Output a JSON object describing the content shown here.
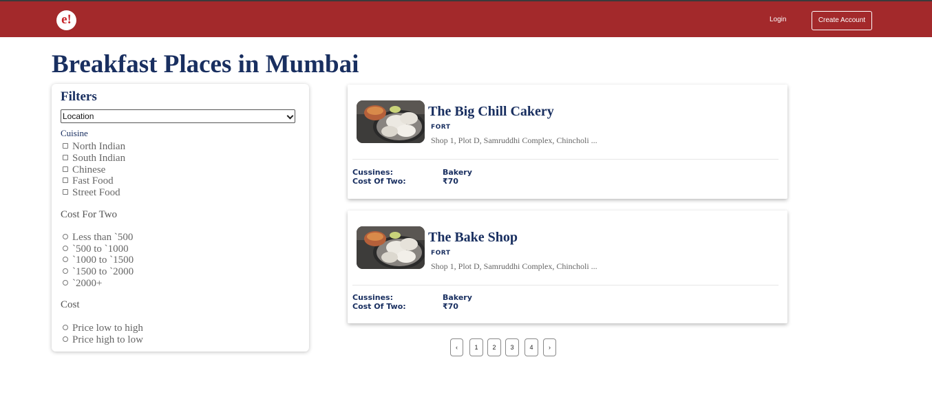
{
  "header": {
    "logo_text": "e!",
    "login_label": "Login",
    "create_account_label": "Create Account",
    "brand_color": "#a3292b"
  },
  "page": {
    "title": "Breakfast Places in Mumbai"
  },
  "filters": {
    "title": "Filters",
    "location_value": "Location",
    "cuisine_label": "Cuisine",
    "cuisines": [
      "North Indian",
      "South Indian",
      "Chinese",
      "Fast Food",
      "Street Food"
    ],
    "cost_label": "Cost For Two",
    "cost_options": [
      "Less than `500",
      "`500 to `1000",
      "`1000 to `1500",
      "`1500 to `2000",
      "`2000+"
    ],
    "sort_label": "Cost",
    "sort_options": [
      "Price low to high",
      "Price high to low"
    ]
  },
  "restaurants": [
    {
      "name": "The Big Chill Cakery",
      "locality": "FORT",
      "address": "Shop 1, Plot D, Samruddhi Complex, Chincholi ...",
      "cuisines_label": "Cussines:",
      "cuisines_value": "Bakery",
      "cost_label": "Cost Of Two:",
      "cost_value": "₹70",
      "image_icon": "idli-food-photo"
    },
    {
      "name": "The Bake Shop",
      "locality": "FORT",
      "address": "Shop 1, Plot D, Samruddhi Complex, Chincholi ...",
      "cuisines_label": "Cussines:",
      "cuisines_value": "Bakery",
      "cost_label": "Cost Of Two:",
      "cost_value": "₹70",
      "image_icon": "idli-food-photo"
    }
  ],
  "pagination": {
    "prev": "‹",
    "pages": [
      "1",
      "2",
      "3",
      "4"
    ],
    "next": "›"
  }
}
